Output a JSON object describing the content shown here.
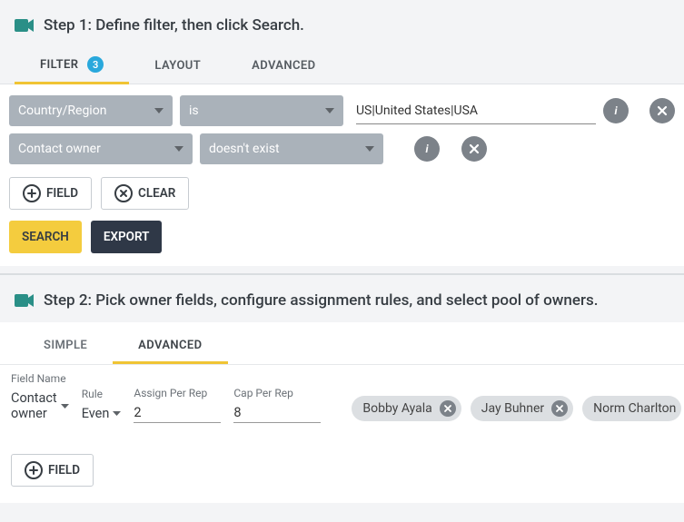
{
  "step1": {
    "title": "Step 1: Define filter, then click Search.",
    "tabs": {
      "filter": "FILTER",
      "layout": "LAYOUT",
      "advanced": "ADVANCED",
      "badge": "3"
    },
    "rows": [
      {
        "field": "Country/Region",
        "op": "is",
        "value": "US|United States|USA"
      },
      {
        "field": "Contact owner",
        "op": "doesn't exist",
        "value": ""
      }
    ],
    "buttons": {
      "field": "FIELD",
      "clear": "CLEAR",
      "search": "SEARCH",
      "export": "EXPORT"
    }
  },
  "step2": {
    "title": "Step 2: Pick owner fields, configure assignment rules, and select pool of owners.",
    "tabs": {
      "simple": "SIMPLE",
      "advanced": "ADVANCED"
    },
    "labels": {
      "fieldName": "Field Name",
      "rule": "Rule",
      "assignPerRep": "Assign Per Rep",
      "capPerRep": "Cap Per Rep"
    },
    "row": {
      "fieldName": "Contact owner",
      "rule": "Even",
      "assignPerRep": "2",
      "capPerRep": "8"
    },
    "chips": [
      "Bobby Ayala",
      "Jay Buhner",
      "Norm Charlton"
    ],
    "buttons": {
      "field": "FIELD"
    }
  }
}
